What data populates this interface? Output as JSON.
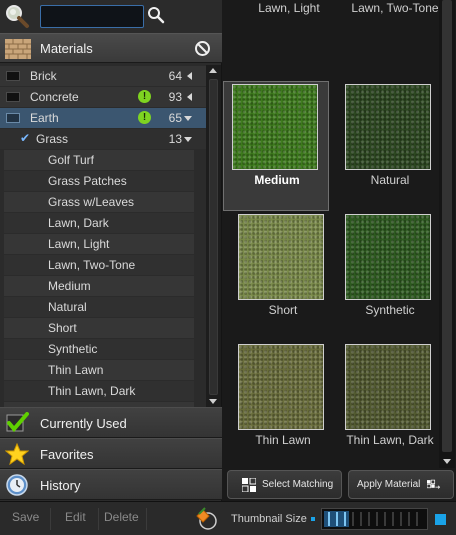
{
  "search": {
    "value": "",
    "placeholder": ""
  },
  "materials": {
    "title": "Materials"
  },
  "categories": [
    {
      "label": "Brick",
      "count": "64",
      "warning": false,
      "expanded": false
    },
    {
      "label": "Concrete",
      "count": "93",
      "warning": true,
      "expanded": false
    },
    {
      "label": "Earth",
      "count": "65",
      "warning": true,
      "expanded": true
    }
  ],
  "subcategory": {
    "label": "Grass",
    "count": "13",
    "expanded": true
  },
  "grass_items": [
    "Golf Turf",
    "Grass Patches",
    "Grass w/Leaves",
    "Lawn, Dark",
    "Lawn, Light",
    "Lawn, Two-Tone",
    "Medium",
    "Natural",
    "Short",
    "Synthetic",
    "Thin Lawn",
    "Thin Lawn, Dark"
  ],
  "sections": {
    "currently_used": "Currently Used",
    "favorites": "Favorites",
    "history": "History"
  },
  "grid": {
    "partial_top": [
      "Lawn, Light",
      "Lawn, Two-Tone"
    ],
    "items": [
      {
        "label": "Medium",
        "color": "#3d7a1c",
        "selected": true
      },
      {
        "label": "Natural",
        "color": "#2c4720",
        "selected": false
      },
      {
        "label": "Short",
        "color": "#7a8a4a",
        "selected": false
      },
      {
        "label": "Synthetic",
        "color": "#2d5a1f",
        "selected": false
      },
      {
        "label": "Thin Lawn",
        "color": "#6a6e3c",
        "selected": false
      },
      {
        "label": "Thin Lawn, Dark",
        "color": "#525a30",
        "selected": false
      }
    ]
  },
  "actions": {
    "select_matching": "Select Matching",
    "apply_material": "Apply Material"
  },
  "bottom": {
    "save": "Save",
    "edit": "Edit",
    "delete": "Delete",
    "thumbnail_size_label": "Thumbnail Size",
    "thumbnail_size_level": 0.25
  },
  "colors": {
    "accent": "#1aa3e8",
    "selected_row": "#3b5670",
    "warning": "#7ed321"
  }
}
